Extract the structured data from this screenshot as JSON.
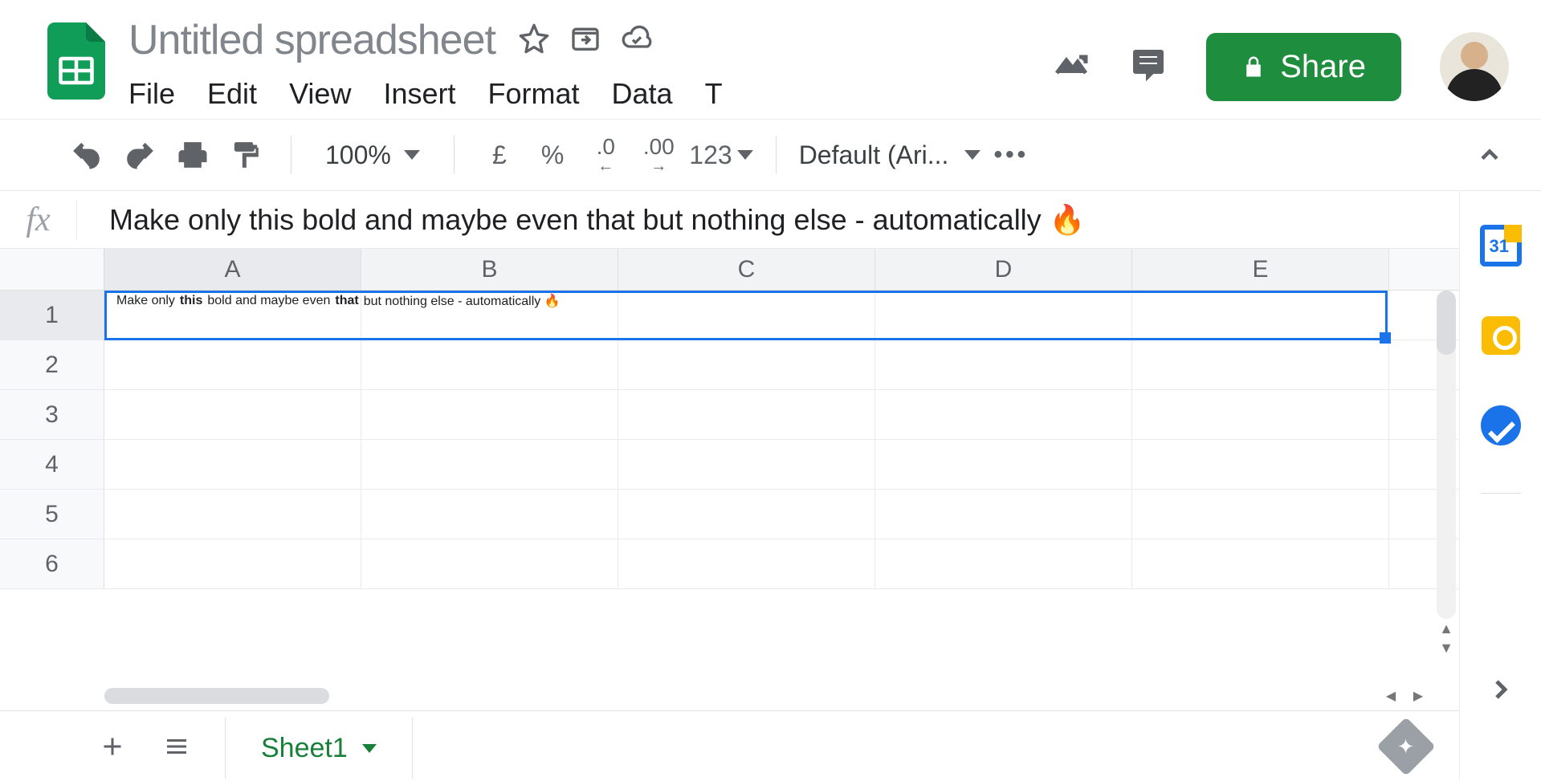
{
  "header": {
    "title": "Untitled spreadsheet",
    "share_label": "Share",
    "menus": [
      "File",
      "Edit",
      "View",
      "Insert",
      "Format",
      "Data",
      "T"
    ]
  },
  "toolbar": {
    "zoom": "100%",
    "currency": "£",
    "percent": "%",
    "dec_decrease": ".0",
    "dec_increase": ".00",
    "number_format": "123",
    "font": "Default (Ari..."
  },
  "formula_bar": {
    "fx": "fx",
    "value": "Make only this bold and maybe even that but nothing else - automatically 🔥"
  },
  "grid": {
    "columns": [
      "A",
      "B",
      "C",
      "D",
      "E"
    ],
    "rows": [
      1,
      2,
      3,
      4,
      5,
      6
    ],
    "active_cell": "A1",
    "cell_runs": [
      {
        "text": "Make only ",
        "bold": false
      },
      {
        "text": "this",
        "bold": true
      },
      {
        "text": " bold and maybe even ",
        "bold": false
      },
      {
        "text": "that",
        "bold": true
      },
      {
        "text": " but nothing else - automatically 🔥",
        "bold": false
      }
    ]
  },
  "tabs": {
    "sheet_name": "Sheet1"
  },
  "side": {
    "calendar_day": "31"
  }
}
